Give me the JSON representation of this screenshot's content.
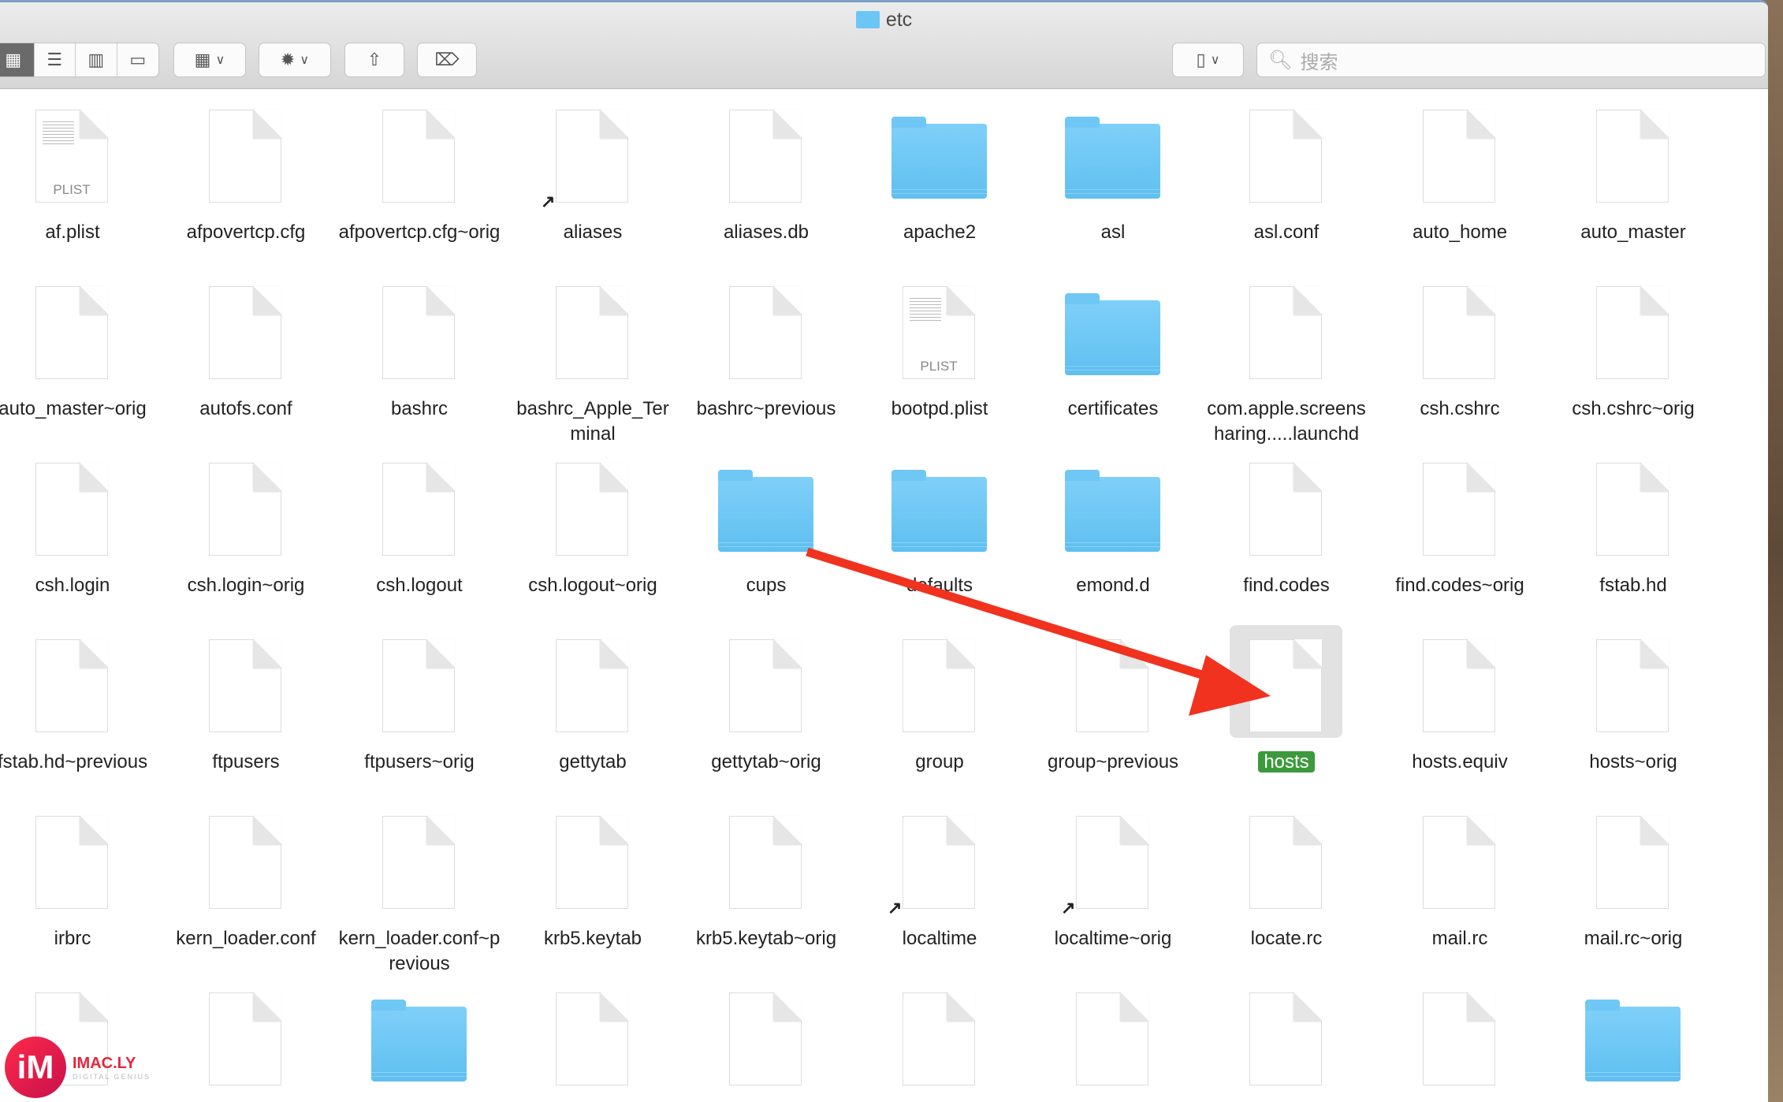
{
  "window": {
    "title": "etc"
  },
  "toolbar": {
    "view_modes": [
      "icon-view",
      "list-view",
      "column-view",
      "gallery-view"
    ],
    "active_view": "icon-view",
    "group_button": "group-by-icon",
    "action_button": "gear-icon",
    "share_button": "share-icon",
    "tag_button": "tag-icon",
    "device_button": "device-icon"
  },
  "search": {
    "placeholder": "搜索"
  },
  "files": [
    {
      "name": "af.plist",
      "type": "plist"
    },
    {
      "name": "afpovertcp.cfg",
      "type": "doc"
    },
    {
      "name": "afpovertcp.cfg~orig",
      "type": "doc"
    },
    {
      "name": "aliases",
      "type": "doc",
      "alias": true
    },
    {
      "name": "aliases.db",
      "type": "doc"
    },
    {
      "name": "apache2",
      "type": "folder"
    },
    {
      "name": "asl",
      "type": "folder"
    },
    {
      "name": "asl.conf",
      "type": "doc"
    },
    {
      "name": "auto_home",
      "type": "doc"
    },
    {
      "name": "auto_master",
      "type": "doc"
    },
    {
      "name": "auto_master~orig",
      "type": "doc"
    },
    {
      "name": "autofs.conf",
      "type": "doc"
    },
    {
      "name": "bashrc",
      "type": "doc"
    },
    {
      "name": "bashrc_Apple_Terminal",
      "type": "doc"
    },
    {
      "name": "bashrc~previous",
      "type": "doc"
    },
    {
      "name": "bootpd.plist",
      "type": "plist"
    },
    {
      "name": "certificates",
      "type": "folder"
    },
    {
      "name": "com.apple.screensharing.....launchd",
      "type": "doc"
    },
    {
      "name": "csh.cshrc",
      "type": "doc"
    },
    {
      "name": "csh.cshrc~orig",
      "type": "doc"
    },
    {
      "name": "csh.login",
      "type": "doc"
    },
    {
      "name": "csh.login~orig",
      "type": "doc"
    },
    {
      "name": "csh.logout",
      "type": "doc"
    },
    {
      "name": "csh.logout~orig",
      "type": "doc"
    },
    {
      "name": "cups",
      "type": "folder"
    },
    {
      "name": "defaults",
      "type": "folder"
    },
    {
      "name": "emond.d",
      "type": "folder"
    },
    {
      "name": "find.codes",
      "type": "doc"
    },
    {
      "name": "find.codes~orig",
      "type": "doc"
    },
    {
      "name": "fstab.hd",
      "type": "doc"
    },
    {
      "name": "fstab.hd~previous",
      "type": "doc"
    },
    {
      "name": "ftpusers",
      "type": "doc"
    },
    {
      "name": "ftpusers~orig",
      "type": "doc"
    },
    {
      "name": "gettytab",
      "type": "doc"
    },
    {
      "name": "gettytab~orig",
      "type": "doc"
    },
    {
      "name": "group",
      "type": "doc"
    },
    {
      "name": "group~previous",
      "type": "doc"
    },
    {
      "name": "hosts",
      "type": "doc",
      "selected": true
    },
    {
      "name": "hosts.equiv",
      "type": "doc"
    },
    {
      "name": "hosts~orig",
      "type": "doc"
    },
    {
      "name": "irbrc",
      "type": "doc"
    },
    {
      "name": "kern_loader.conf",
      "type": "doc"
    },
    {
      "name": "kern_loader.conf~previous",
      "type": "doc"
    },
    {
      "name": "krb5.keytab",
      "type": "doc"
    },
    {
      "name": "krb5.keytab~orig",
      "type": "doc"
    },
    {
      "name": "localtime",
      "type": "doc",
      "alias": true
    },
    {
      "name": "localtime~orig",
      "type": "doc",
      "alias": true
    },
    {
      "name": "locate.rc",
      "type": "doc"
    },
    {
      "name": "mail.rc",
      "type": "doc"
    },
    {
      "name": "mail.rc~orig",
      "type": "doc"
    },
    {
      "name": "",
      "type": "doc"
    },
    {
      "name": "",
      "type": "doc"
    },
    {
      "name": "",
      "type": "folder"
    },
    {
      "name": "",
      "type": "doc"
    },
    {
      "name": "",
      "type": "doc"
    },
    {
      "name": "",
      "type": "doc"
    },
    {
      "name": "",
      "type": "doc"
    },
    {
      "name": "",
      "type": "doc"
    },
    {
      "name": "",
      "type": "doc"
    },
    {
      "name": "",
      "type": "folder"
    }
  ],
  "plist_badge": "PLIST",
  "annotation": {
    "arrow_color": "#f0321e",
    "target": "hosts"
  },
  "selection_color": "#3c9a3c",
  "watermark": {
    "logo": "iM",
    "name": "IMAC.LY",
    "tagline": "DIGITAL GENIUS"
  }
}
